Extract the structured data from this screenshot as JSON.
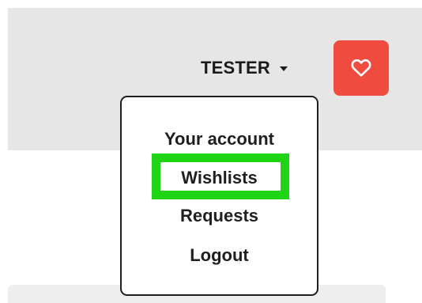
{
  "header": {
    "username": "TESTER",
    "caret_icon": "caret-down-icon",
    "wishlist_icon": "heart-outline-icon",
    "wishlist_button_color": "#ef4b3f"
  },
  "user_menu": {
    "items": [
      {
        "label": "Your account"
      },
      {
        "label": "Wishlists",
        "highlighted": true
      },
      {
        "label": "Requests"
      },
      {
        "label": "Logout"
      }
    ],
    "highlight_color": "#1ed414"
  }
}
